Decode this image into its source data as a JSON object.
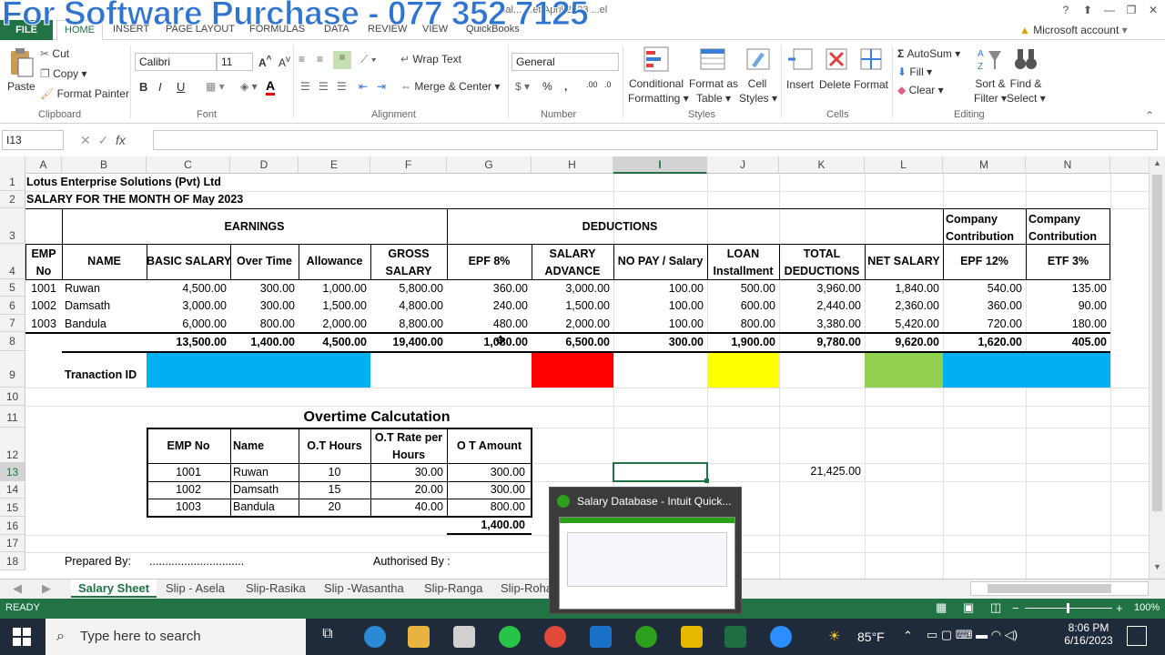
{
  "overlay_banner": "For Software Purchase - 077 352 7125",
  "window": {
    "title_fragment": "Sal... ...et April 2023 ...el",
    "help": "?",
    "account": "Microsoft account"
  },
  "ribbon_tabs": [
    "FILE",
    "HOME",
    "INSERT",
    "PAGE LAYOUT",
    "FORMULAS",
    "DATA",
    "REVIEW",
    "VIEW",
    "QuickBooks"
  ],
  "ribbon": {
    "clipboard": {
      "paste": "Paste",
      "cut": "Cut",
      "copy": "Copy",
      "format_painter": "Format Painter",
      "group": "Clipboard"
    },
    "font": {
      "name": "Calibri",
      "size": "11",
      "group": "Font",
      "bold": "B",
      "italic": "I",
      "underline": "U"
    },
    "alignment": {
      "wrap": "Wrap Text",
      "merge": "Merge & Center",
      "group": "Alignment"
    },
    "number": {
      "format": "General",
      "group": "Number",
      "percent": "%",
      "comma": ","
    },
    "styles": {
      "cond": "Conditional Formatting",
      "cond1": "Conditional",
      "cond2": "Formatting",
      "fmt_table1": "Format as",
      "fmt_table2": "Table",
      "cell_styles1": "Cell",
      "cell_styles2": "Styles",
      "group": "Styles"
    },
    "cells": {
      "insert": "Insert",
      "delete": "Delete",
      "format": "Format",
      "group": "Cells"
    },
    "editing": {
      "autosum": "AutoSum",
      "fill": "Fill",
      "clear": "Clear",
      "sort1": "Sort &",
      "sort2": "Filter",
      "find1": "Find &",
      "find2": "Select",
      "group": "Editing"
    }
  },
  "formula_bar": {
    "name_box": "I13",
    "fx": "fx",
    "value": ""
  },
  "columns": [
    "A",
    "B",
    "C",
    "D",
    "E",
    "F",
    "G",
    "H",
    "I",
    "J",
    "K",
    "L",
    "M",
    "N"
  ],
  "rows": [
    "1",
    "2",
    "3",
    "4",
    "5",
    "6",
    "7",
    "8",
    "9",
    "10",
    "11",
    "12",
    "13",
    "14",
    "15",
    "16",
    "17",
    "18"
  ],
  "sheet": {
    "company": "Lotus Enterprise Solutions  (Pvt) Ltd",
    "month": "SALARY  FOR THE MONTH OF May 2023",
    "earnings": "EARNINGS",
    "deductions": "DEDUCTIONS",
    "company_contribution": "Company Contribution",
    "company_contribution_l1": "Company",
    "company_contribution_l2": "Contribution",
    "headers": {
      "emp_l1": "EMP",
      "emp_l2": "No",
      "name": "NAME",
      "basic": "BASIC SALARY",
      "ot": "Over Time",
      "allow": "Allowance",
      "gross_l1": "GROSS",
      "gross_l2": "SALARY",
      "epf8": "EPF 8%",
      "adv_l1": "SALARY",
      "adv_l2": "ADVANCE",
      "nopay": "NO PAY / Salary",
      "loan_l1": "LOAN",
      "loan_l2": "Installment",
      "totded_l1": "TOTAL",
      "totded_l2": "DEDUCTIONS",
      "net": "NET SALARY",
      "epf12": "EPF 12%",
      "etf3": "ETF 3%"
    },
    "employees": [
      {
        "no": "1001",
        "name": "Ruwan",
        "basic": "4,500.00",
        "ot": "300.00",
        "allow": "1,000.00",
        "gross": "5,800.00",
        "epf": "360.00",
        "adv": "3,000.00",
        "nopay": "100.00",
        "loan": "500.00",
        "tot": "3,960.00",
        "net": "1,840.00",
        "epf12": "540.00",
        "etf": "135.00"
      },
      {
        "no": "1002",
        "name": "Damsath",
        "basic": "3,000.00",
        "ot": "300.00",
        "allow": "1,500.00",
        "gross": "4,800.00",
        "epf": "240.00",
        "adv": "1,500.00",
        "nopay": "100.00",
        "loan": "600.00",
        "tot": "2,440.00",
        "net": "2,360.00",
        "epf12": "360.00",
        "etf": "90.00"
      },
      {
        "no": "1003",
        "name": "Bandula",
        "basic": "6,000.00",
        "ot": "800.00",
        "allow": "2,000.00",
        "gross": "8,800.00",
        "epf": "480.00",
        "adv": "2,000.00",
        "nopay": "100.00",
        "loan": "800.00",
        "tot": "3,380.00",
        "net": "5,420.00",
        "epf12": "720.00",
        "etf": "180.00"
      }
    ],
    "totals": {
      "basic": "13,500.00",
      "ot": "1,400.00",
      "allow": "4,500.00",
      "gross": "19,400.00",
      "epf": "1,080.00",
      "adv": "6,500.00",
      "nopay": "300.00",
      "loan": "1,900.00",
      "tot": "9,780.00",
      "net": "9,620.00",
      "epf12": "1,620.00",
      "etf": "405.00"
    },
    "transaction_id": "Tranaction ID",
    "ot_title": "Overtime Calcutation",
    "ot_headers": {
      "emp": "EMP No",
      "name": "Name",
      "hours": "O.T Hours",
      "rate_l1": "O.T Rate per",
      "rate_l2": "Hours",
      "amount": "O T Amount"
    },
    "ot_rows": [
      {
        "emp": "1001",
        "name": "Ruwan",
        "hours": "10",
        "rate": "30.00",
        "amount": "300.00"
      },
      {
        "emp": "1002",
        "name": "Damsath",
        "hours": "15",
        "rate": "20.00",
        "amount": "300.00"
      },
      {
        "emp": "1003",
        "name": "Bandula",
        "hours": "20",
        "rate": "40.00",
        "amount": "800.00"
      }
    ],
    "ot_total": "1,400.00",
    "k13": "21,425.00",
    "prepared_by": "Prepared By:",
    "prepared_dots": "..............................",
    "authorised_by": "Authorised By :"
  },
  "fill_colors": {
    "blue": "#00b0f0",
    "red": "#ff0000",
    "yellow": "#ffff00",
    "green": "#92d050"
  },
  "sheet_tabs": [
    "Salary Sheet",
    "Slip - Asela",
    "Slip-Rasika",
    "Slip -Wasantha",
    "Slip-Ranga",
    "Slip-Roha"
  ],
  "status": {
    "ready": "READY",
    "zoom": "100%"
  },
  "taskbar": {
    "search_placeholder": "Type here to search",
    "weather": "85°F",
    "time": "8:06 PM",
    "date": "6/16/2023"
  },
  "popup": {
    "title": "Salary Database - Intuit Quick..."
  }
}
